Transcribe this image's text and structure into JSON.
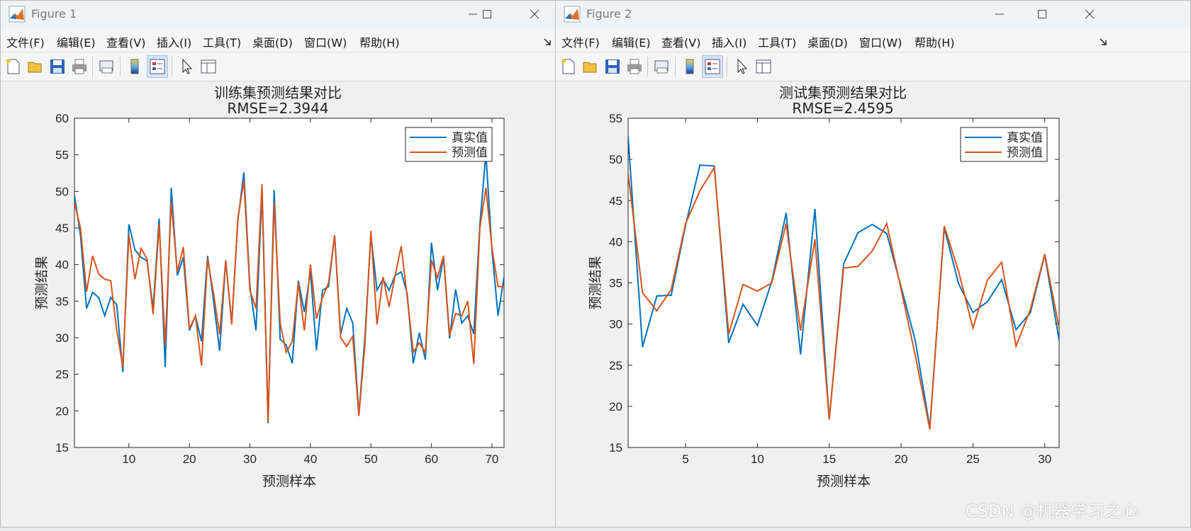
{
  "watermark": "CSDN @机器学习之心",
  "colors": {
    "real": "#0072bd",
    "pred": "#d95319"
  },
  "windows": [
    {
      "title": "Figure 1",
      "menu": [
        "文件(F)",
        "编辑(E)",
        "查看(V)",
        "插入(I)",
        "工具(T)",
        "桌面(D)",
        "窗口(W)",
        "帮助(H)"
      ],
      "toolbar_icons": [
        "new-file-icon",
        "open-folder-icon",
        "save-icon",
        "print-icon",
        "print-preview-icon",
        "colorbar-icon",
        "legend-icon",
        "pointer-icon",
        "property-editor-icon"
      ],
      "chart_data": {
        "type": "line",
        "title": "训练集预测结果对比",
        "subtitle": "RMSE=2.3944",
        "xlabel": "预测样本",
        "ylabel": "预测结果",
        "xlim": [
          1,
          72
        ],
        "ylim": [
          15,
          60
        ],
        "xticks": [
          10,
          20,
          30,
          40,
          50,
          60,
          70
        ],
        "yticks": [
          15,
          20,
          25,
          30,
          35,
          40,
          45,
          50,
          55,
          60
        ],
        "legend": {
          "placement": "top-right",
          "entries": [
            "真实值",
            "预测值"
          ]
        },
        "grid": false,
        "series": [
          {
            "name": "真实值",
            "color": "#0072bd",
            "values": [
              49.5,
              44,
              34,
              36.2,
              35.5,
              33,
              35.5,
              34.5,
              25.3,
              45.5,
              42,
              41,
              40.5,
              34,
              46.3,
              26,
              50.5,
              38.5,
              41,
              31,
              33,
              29.5,
              41.2,
              35,
              28.2,
              40.5,
              32,
              46,
              52.6,
              37,
              31,
              50,
              18.3,
              50.2,
              29.8,
              29,
              26.5,
              37.8,
              33.5,
              39,
              28.3,
              36.5,
              37,
              44,
              30.5,
              34,
              32,
              19.5,
              30,
              44,
              36.5,
              38,
              36.5,
              38.5,
              39,
              36,
              26.5,
              30.7,
              27,
              43,
              36.5,
              41,
              29.9,
              36.6,
              32,
              33,
              30.5,
              45.5,
              55.2,
              42,
              33,
              38.3
            ]
          },
          {
            "name": "预测值",
            "color": "#d95319",
            "values": [
              48.5,
              45,
              36.3,
              41.2,
              38.7,
              38,
              37.8,
              31,
              26,
              44,
              38,
              42.2,
              40.8,
              33.2,
              45.5,
              29,
              48.5,
              39,
              42.4,
              31.2,
              33,
              26.2,
              40.8,
              36,
              30.5,
              40.6,
              31.8,
              46.3,
              51.5,
              36.5,
              34,
              51,
              18.5,
              48.5,
              32,
              28,
              29.5,
              37.5,
              31,
              40,
              32.6,
              35.5,
              37.5,
              44,
              30,
              28.8,
              30.2,
              19.3,
              29,
              44.6,
              31.8,
              38.3,
              34.2,
              38.5,
              42.5,
              35.6,
              28,
              29.3,
              28,
              40.6,
              38.2,
              41.2,
              30.3,
              33.3,
              33,
              35,
              26.4,
              45,
              50.5,
              42.3,
              37,
              37
            ]
          }
        ]
      }
    },
    {
      "title": "Figure 2",
      "menu": [
        "文件(F)",
        "编辑(E)",
        "查看(V)",
        "插入(I)",
        "工具(T)",
        "桌面(D)",
        "窗口(W)",
        "帮助(H)"
      ],
      "toolbar_icons": [
        "new-file-icon",
        "open-folder-icon",
        "save-icon",
        "print-icon",
        "print-preview-icon",
        "colorbar-icon",
        "legend-icon",
        "pointer-icon",
        "property-editor-icon"
      ],
      "chart_data": {
        "type": "line",
        "title": "测试集预测结果对比",
        "subtitle": "RMSE=2.4595",
        "xlabel": "预测样本",
        "ylabel": "预测结果",
        "xlim": [
          1,
          31
        ],
        "ylim": [
          15,
          55
        ],
        "xticks": [
          5,
          10,
          15,
          20,
          25,
          30
        ],
        "yticks": [
          15,
          20,
          25,
          30,
          35,
          40,
          45,
          50,
          55
        ],
        "legend": {
          "placement": "top-right",
          "entries": [
            "真实值",
            "预测值"
          ]
        },
        "grid": false,
        "series": [
          {
            "name": "真实值",
            "color": "#0072bd",
            "values": [
              52.8,
              27.2,
              33.4,
              33.5,
              42,
              49.3,
              49.2,
              27.7,
              32.4,
              29.8,
              35.2,
              43.5,
              26.3,
              44,
              18.4,
              37.3,
              41.1,
              42.1,
              41,
              34.5,
              27.9,
              17.4,
              41.7,
              34.9,
              31.4,
              32.7,
              35.4,
              29.3,
              31.4,
              38.4,
              28
            ]
          },
          {
            "name": "预测值",
            "color": "#d95319",
            "values": [
              48.3,
              33.8,
              31.6,
              34.2,
              42.2,
              46.2,
              49,
              28.8,
              34.8,
              34,
              35,
              42.2,
              29.2,
              40.3,
              18.4,
              36.8,
              37,
              38.9,
              42.2,
              34.2,
              26.1,
              17.2,
              41.9,
              36.4,
              29.5,
              35.3,
              37.5,
              27.3,
              31.8,
              38.5,
              29.5
            ]
          }
        ]
      }
    }
  ]
}
